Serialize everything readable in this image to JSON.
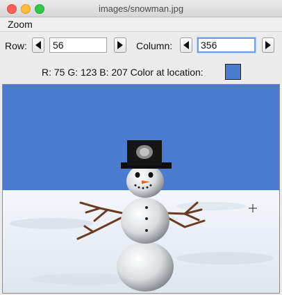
{
  "window": {
    "title": "images/snowman.jpg"
  },
  "menu": {
    "zoom_label": "Zoom"
  },
  "controls": {
    "row_label": "Row:",
    "row_value": "56",
    "column_label": "Column:",
    "column_value": "356"
  },
  "pixel_info": {
    "text": "R: 75 G: 123 B: 207 Color at location:",
    "swatch_color": "#4b7bcf"
  },
  "image": {
    "sky_color": "#4b7bcf",
    "snow_color": "#e8eef6"
  }
}
